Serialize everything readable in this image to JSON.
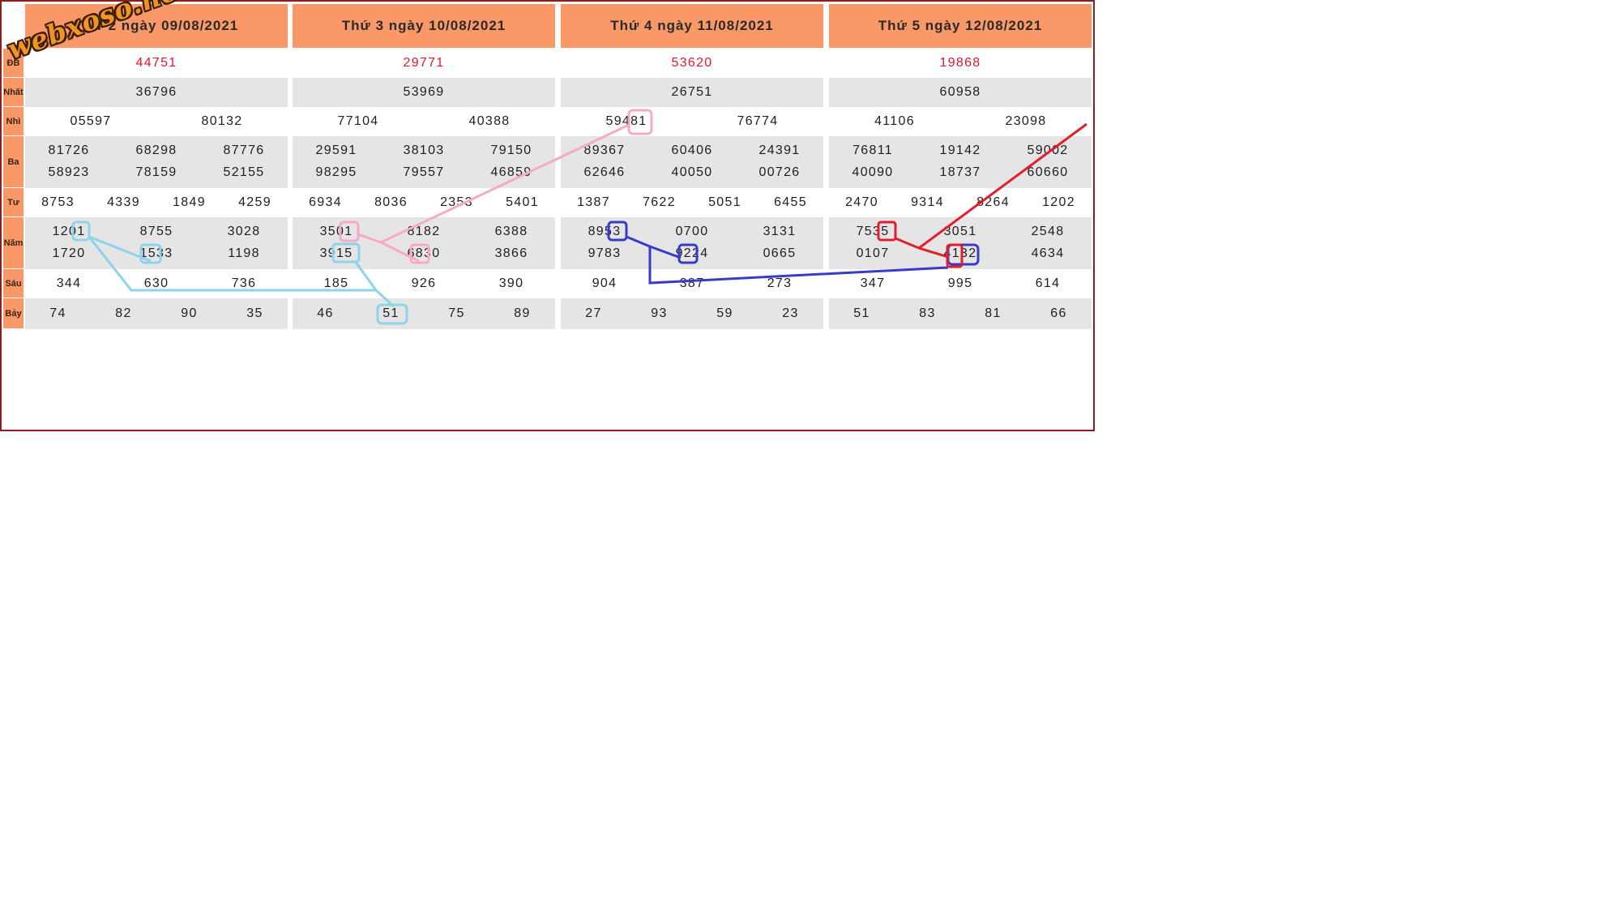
{
  "logo": "webxoso.net",
  "columns": [
    {
      "header": "Thứ 2 ngày 09/08/2021",
      "special": [
        "44751"
      ],
      "first": [
        "36796"
      ],
      "second": [
        "05597",
        "80132"
      ],
      "third": [
        "81726",
        "68298",
        "87776",
        "58923",
        "78159",
        "52155"
      ],
      "fourth": [
        "8753",
        "4339",
        "1849",
        "4259"
      ],
      "fifth": [
        "1201",
        "8755",
        "3028",
        "1720",
        "1533",
        "1198"
      ],
      "sixth": [
        "344",
        "630",
        "736"
      ],
      "seventh": [
        "74",
        "82",
        "90",
        "35"
      ]
    },
    {
      "header": "Thứ 3 ngày 10/08/2021",
      "special": [
        "29771"
      ],
      "first": [
        "53969"
      ],
      "second": [
        "77104",
        "40388"
      ],
      "third": [
        "29591",
        "38103",
        "79150",
        "98295",
        "79557",
        "46859"
      ],
      "fourth": [
        "6934",
        "8036",
        "2353",
        "5401"
      ],
      "fifth": [
        "3501",
        "8182",
        "6388",
        "3915",
        "6830",
        "3866"
      ],
      "sixth": [
        "185",
        "926",
        "390"
      ],
      "seventh": [
        "46",
        "51",
        "75",
        "89"
      ]
    },
    {
      "header": "Thứ 4 ngày 11/08/2021",
      "special": [
        "53620"
      ],
      "first": [
        "26751"
      ],
      "second": [
        "59481",
        "76774"
      ],
      "third": [
        "89367",
        "60406",
        "24391",
        "62646",
        "40050",
        "00726"
      ],
      "fourth": [
        "1387",
        "7622",
        "5051",
        "6455"
      ],
      "fifth": [
        "8953",
        "0700",
        "3131",
        "9783",
        "9224",
        "0665"
      ],
      "sixth": [
        "904",
        "387",
        "273"
      ],
      "seventh": [
        "27",
        "93",
        "59",
        "23"
      ]
    },
    {
      "header": "Thứ 5 ngày 12/08/2021",
      "special": [
        "19868"
      ],
      "first": [
        "60958"
      ],
      "second": [
        "41106",
        "23098"
      ],
      "third": [
        "76811",
        "19142",
        "59002",
        "40090",
        "18737",
        "60660"
      ],
      "fourth": [
        "2470",
        "9314",
        "8264",
        "1202"
      ],
      "fifth": [
        "7535",
        "3051",
        "2548",
        "0107",
        "4132",
        "4634"
      ],
      "sixth": [
        "347",
        "995",
        "614"
      ],
      "seventh": [
        "51",
        "83",
        "81",
        "66"
      ]
    }
  ],
  "row_labels": [
    "ĐB",
    "Nhất",
    "Nhì",
    "Ba",
    "Tư",
    "Năm",
    "Sáu",
    "Bảy"
  ],
  "colors": {
    "header_bg": "#fa9868",
    "band_bg": "#e5e5e5",
    "special_text": "#e3162a",
    "frame_border": "#8f1d1d",
    "trace_light_blue": "#8dd4ea",
    "trace_pink": "#f7a9c8",
    "trace_blue": "#3a3ac8",
    "trace_red": "#e01f2a"
  }
}
